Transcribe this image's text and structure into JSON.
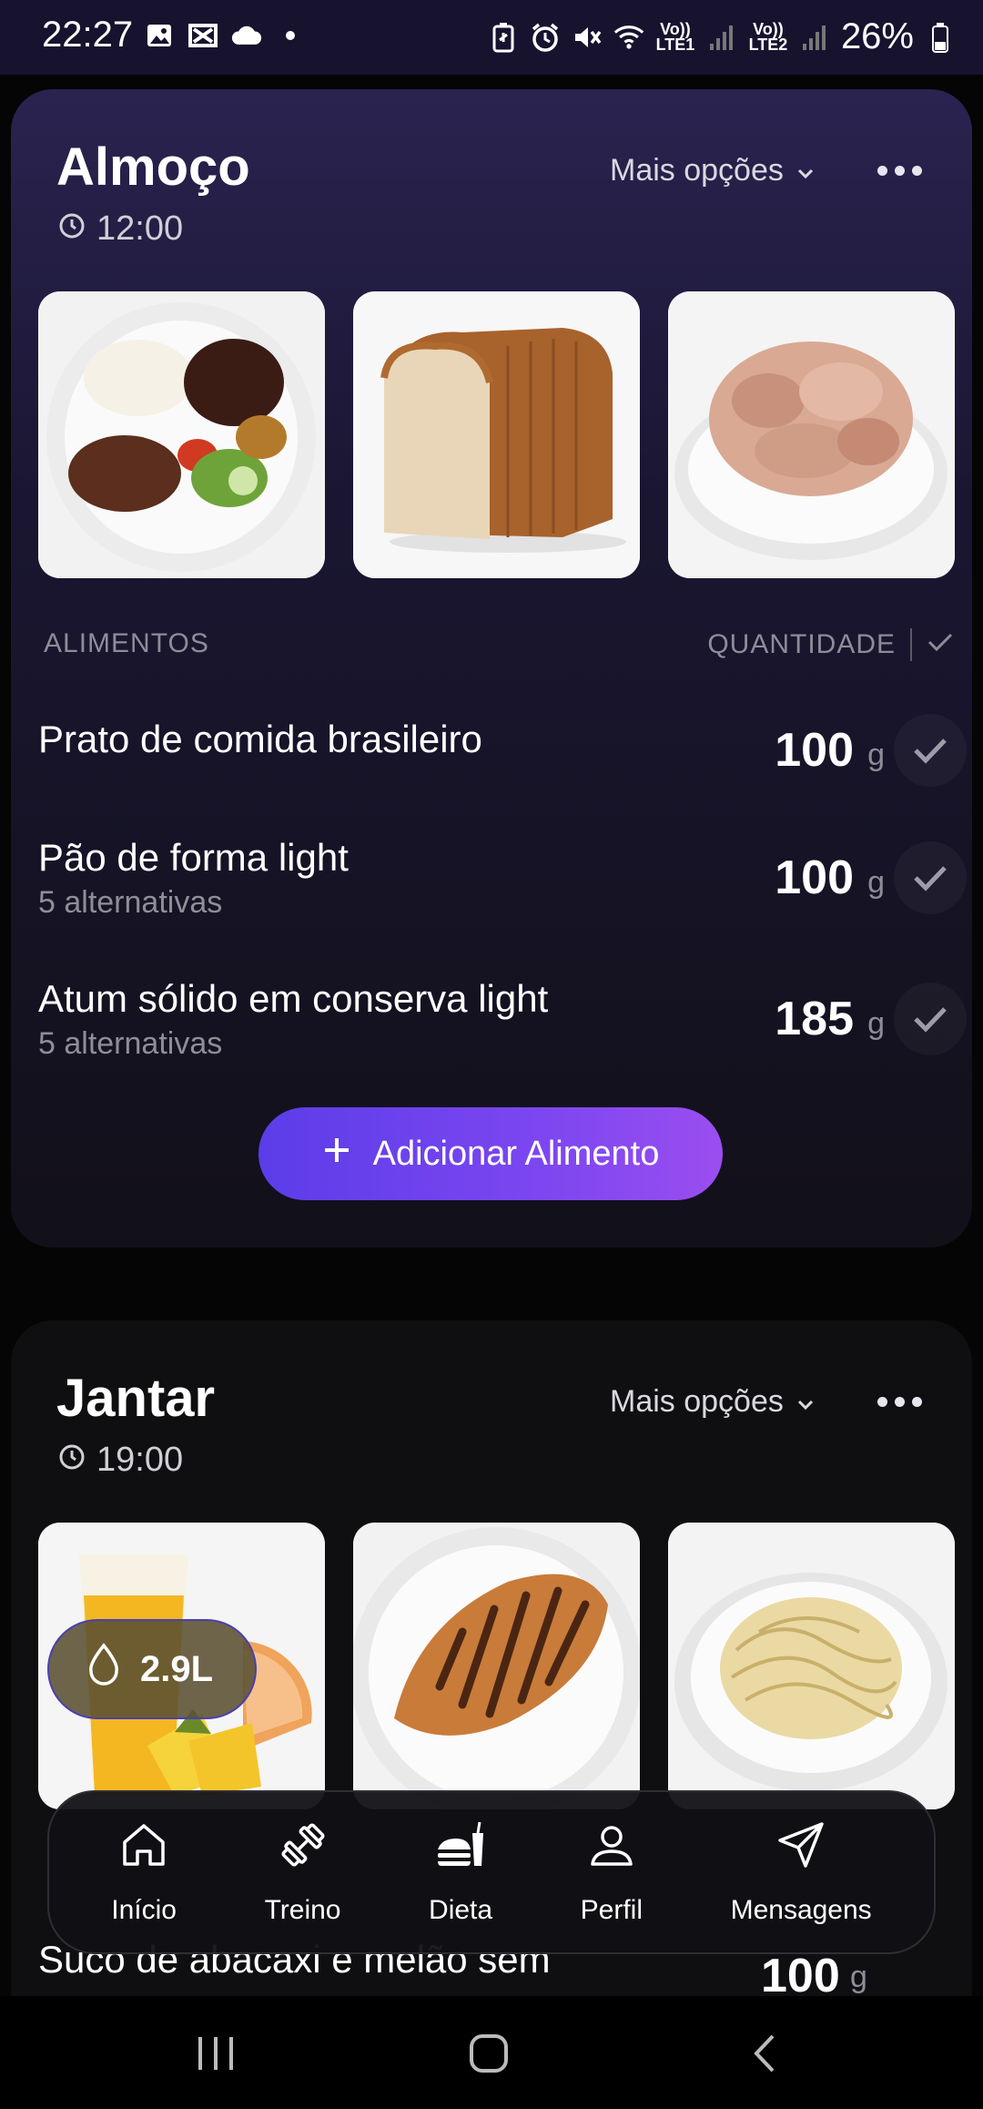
{
  "status_bar": {
    "time": "22:27",
    "vo_lte1": "Vo)) LTE1",
    "vo_lte2": "Vo)) LTE2",
    "battery": "26%"
  },
  "lunch": {
    "title": "Almoço",
    "time": "12:00",
    "more_options": "Mais opções",
    "photos": [
      "brazilian-plate-photo",
      "sliced-bread-photo",
      "tuna-photo"
    ],
    "list_header": {
      "foods": "ALIMENTOS",
      "quantity": "QUANTIDADE"
    },
    "items": [
      {
        "name": "Prato de comida brasileiro",
        "alternatives": "",
        "amount": "100",
        "unit": "g"
      },
      {
        "name": "Pão de forma light",
        "alternatives": "5 alternativas",
        "amount": "100",
        "unit": "g"
      },
      {
        "name": "Atum sólido em conserva light",
        "alternatives": "5 alternativas",
        "amount": "185",
        "unit": "g"
      }
    ],
    "add_button": "Adicionar Alimento"
  },
  "dinner": {
    "title": "Jantar",
    "time": "19:00",
    "more_options": "Mais opções",
    "photos": [
      "juice-fruit-photo",
      "grilled-chicken-photo",
      "spaghetti-photo"
    ],
    "peek_item": {
      "name": "Suco de abacaxi e melão sem",
      "amount": "100",
      "unit": "g"
    }
  },
  "water": {
    "value": "2.9L"
  },
  "nav": [
    {
      "label": "Início",
      "icon": "home-icon"
    },
    {
      "label": "Treino",
      "icon": "dumbbell-icon"
    },
    {
      "label": "Dieta",
      "icon": "food-icon"
    },
    {
      "label": "Perfil",
      "icon": "person-icon"
    },
    {
      "label": "Mensagens",
      "icon": "send-icon"
    }
  ],
  "colors": {
    "accent_start": "#5b3de8",
    "accent_end": "#9a4ef0",
    "card_top": "#2a2350",
    "background": "#050505"
  }
}
